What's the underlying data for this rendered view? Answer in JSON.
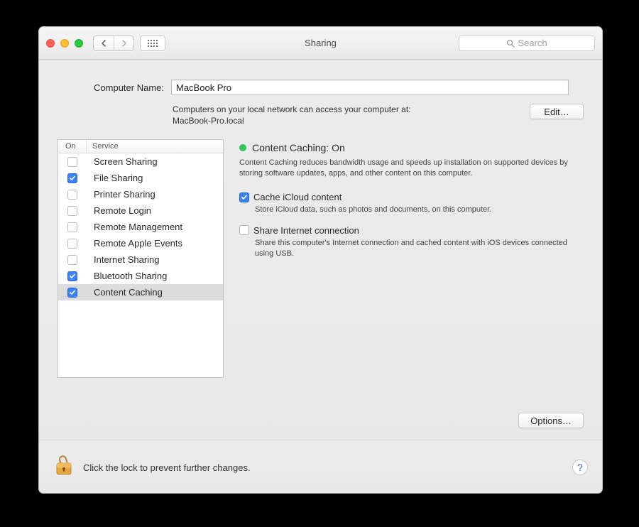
{
  "window": {
    "title": "Sharing"
  },
  "toolbar": {
    "search_placeholder": "Search"
  },
  "computer_name": {
    "label": "Computer Name:",
    "value": "MacBook Pro",
    "access_msg_1": "Computers on your local network can access your computer at:",
    "access_msg_2": "MacBook-Pro.local",
    "edit_label": "Edit…"
  },
  "list": {
    "header_on": "On",
    "header_service": "Service",
    "rows": [
      {
        "label": "Screen Sharing",
        "on": false,
        "selected": false
      },
      {
        "label": "File Sharing",
        "on": true,
        "selected": false
      },
      {
        "label": "Printer Sharing",
        "on": false,
        "selected": false
      },
      {
        "label": "Remote Login",
        "on": false,
        "selected": false
      },
      {
        "label": "Remote Management",
        "on": false,
        "selected": false
      },
      {
        "label": "Remote Apple Events",
        "on": false,
        "selected": false
      },
      {
        "label": "Internet Sharing",
        "on": false,
        "selected": false
      },
      {
        "label": "Bluetooth Sharing",
        "on": true,
        "selected": false
      },
      {
        "label": "Content Caching",
        "on": true,
        "selected": true
      }
    ]
  },
  "detail": {
    "status_label": "Content Caching: On",
    "description": "Content Caching reduces bandwidth usage and speeds up installation on supported devices by storing software updates, apps, and other content on this computer.",
    "opt1": {
      "label": "Cache iCloud content",
      "on": true,
      "desc": "Store iCloud data, such as photos and documents, on this computer."
    },
    "opt2": {
      "label": "Share Internet connection",
      "on": false,
      "desc": "Share this computer's Internet connection and cached content with iOS devices connected using USB."
    },
    "options_button": "Options…"
  },
  "footer": {
    "text": "Click the lock to prevent further changes."
  }
}
